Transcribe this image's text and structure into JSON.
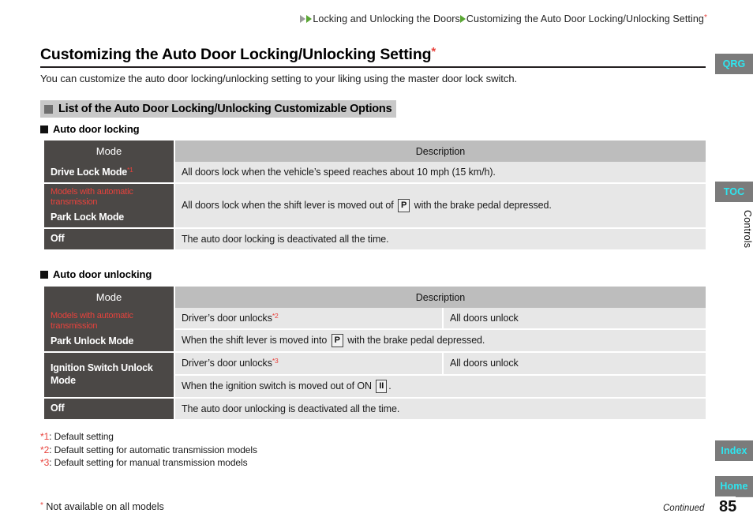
{
  "breadcrumb": {
    "item1": "Locking and Unlocking the Doors",
    "item2": "Customizing the Auto Door Locking/Unlocking Setting",
    "star": "*"
  },
  "title": {
    "text": "Customizing the Auto Door Locking/Unlocking Setting",
    "star": "*"
  },
  "intro": "You can customize the auto door locking/unlocking setting to your liking using the master door lock switch.",
  "section_banner": "List of the Auto Door Locking/Unlocking Customizable Options",
  "subheads": {
    "locking": "Auto door locking",
    "unlocking": "Auto door unlocking"
  },
  "table_locking": {
    "headers": {
      "mode": "Mode",
      "description": "Description"
    },
    "rows": [
      {
        "mode": "Drive Lock Mode",
        "mode_sup": "*1",
        "models_note": "",
        "description": "All doors lock when the vehicle’s speed reaches about 10 mph (15 km/h)."
      },
      {
        "mode": "Park Lock Mode",
        "mode_sup": "",
        "models_note": "Models with automatic transmission",
        "description_pre": "All doors lock when the shift lever is moved out of",
        "keybox": "P",
        "description_post": "with the brake pedal depressed."
      },
      {
        "mode": "Off",
        "mode_sup": "",
        "models_note": "",
        "description": "The auto door locking is deactivated all the time."
      }
    ]
  },
  "table_unlocking": {
    "headers": {
      "mode": "Mode",
      "description": "Description"
    },
    "rows": [
      {
        "mode": "Park Unlock Mode",
        "models_note": "Models with automatic transmission",
        "line1_left": "Driver’s door unlocks",
        "line1_left_sup": "*2",
        "line1_right": "All doors unlock",
        "line2_pre": "When the shift lever is moved into",
        "line2_keybox": "P",
        "line2_post": "with the brake pedal depressed."
      },
      {
        "mode": "Ignition Switch Unlock Mode",
        "models_note": "",
        "line1_left": "Driver’s door unlocks",
        "line1_left_sup": "*3",
        "line1_right": "All doors unlock",
        "line2_pre": "When the ignition switch is moved out of ON",
        "line2_keybox": "II",
        "line2_post": "."
      },
      {
        "mode": "Off",
        "models_note": "",
        "description": "The auto door unlocking is deactivated all the time."
      }
    ]
  },
  "footnotes": [
    {
      "mark": "*1",
      "text": ": Default setting"
    },
    {
      "mark": "*2",
      "text": ": Default setting for automatic transmission models"
    },
    {
      "mark": "*3",
      "text": ": Default setting for manual transmission models"
    }
  ],
  "bottom_note": {
    "star": "*",
    "text": "Not available on all models"
  },
  "continued": "Continued",
  "page_number": "85",
  "side_tabs": {
    "qrg": "QRG",
    "toc": "TOC",
    "index": "Index",
    "home": "Home",
    "controls": "Controls"
  },
  "colors": {
    "accent_red": "#e8423c",
    "tab_cyan": "#2ee6f0",
    "tab_gray": "#7b7b7b",
    "header_dark": "#4b4846",
    "header_light": "#bdbdbd",
    "cell_light": "#e7e7e7",
    "banner_gray": "#c8c8c8",
    "breadcrumb_arrow_green": "#5aa634"
  }
}
